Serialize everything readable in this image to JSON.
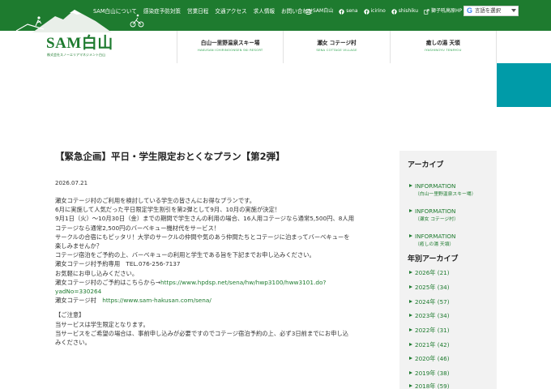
{
  "top_nav": [
    "SAM白山について",
    "感染症予防対策",
    "営業日程",
    "交通アクセス",
    "求人情報",
    "お問い合わせ"
  ],
  "social": [
    {
      "icon": "instagram-icon",
      "label": "SAM白山"
    },
    {
      "icon": "facebook-icon",
      "label": "sena"
    },
    {
      "icon": "facebook-icon",
      "label": "icirino"
    },
    {
      "icon": "facebook-icon",
      "label": "shishiku"
    },
    {
      "icon": "external-link-icon",
      "label": "獅子吼高原HP"
    }
  ],
  "language": {
    "logo": "G",
    "label": "言語を選択"
  },
  "logo": {
    "text": "SAM白山",
    "sub": "株式会社スノーエリアマネジメント白山"
  },
  "main_nav": [
    {
      "title": "白山一里野温泉スキー場",
      "sub": "HAKUSAN ICHIRINOONSEN SKI RESORT"
    },
    {
      "title": "瀬女 コテージ村",
      "sub": "SENA COTTAGE VILLAGE"
    },
    {
      "title": "癒しの湯 天領",
      "sub": "IYASHINOYU TENRYOU"
    }
  ],
  "post": {
    "title": "【緊急企画】平日・学生限定おとくなプラン【第2弾】",
    "date": "2026.07.21",
    "lines": [
      "瀬女コテージ村のご利用を検討している学生の皆さんにお得なプランです。",
      "6月に実施して人気だった平日限定学生割引を第2弾として9月、10月の実施が決定！",
      "9月1日（火）～10月30日（金）までの期間で学生さんの利用の場合、16人用コテージなら通常5,500円、8人用",
      "コテージなら通常2,500円のバーベキュー機材代をサービス！",
      "サークルの合宿にもピッタリ！大学のサークルの仲間や気のあう仲間たちとコテージに泊まってバーベキューを",
      "楽しみませんか？",
      "コテージ宿泊をご予約の上、バーベキューの利用と学生である旨を下記までお申し込みください。",
      "瀬女コテージ村予約専用　TEL.076-256-7137",
      "お気軽にお申し込みください。"
    ],
    "reserve_prefix": "瀬女コテージ村のご予約はこちらから→",
    "reserve_url_1": "https://www.hpdsp.net/sena/hw/hwp3100/hww3101.do?",
    "reserve_url_2": "yadNo=330264",
    "site_prefix": "瀬女コテージ村　",
    "site_url": "https://www.sam-hakusan.com/sena/",
    "notes_title": "【ご注意】",
    "notes": [
      "当サービスは学生限定となります。",
      "当サービスをご希望の場合は、事前申し込みが必要ですのでコテージ宿泊予約の上、必ず3日前までにお申し込",
      "みください。"
    ]
  },
  "sidebar": {
    "archive_title": "アーカイブ",
    "archive": [
      {
        "name": "INFORMATION",
        "sub": "（白山一里野温泉スキー場）"
      },
      {
        "name": "INFORMATION",
        "sub": "（瀬女 コテージ村）"
      },
      {
        "name": "INFORMATION",
        "sub": "（癒しの湯 天領）"
      }
    ],
    "yearly_title": "年別アーカイブ",
    "years": [
      "2026年 (21)",
      "2025年 (34)",
      "2024年 (57)",
      "2023年 (34)",
      "2022年 (31)",
      "2021年 (42)",
      "2020年 (46)",
      "2019年 (38)",
      "2018年 (59)"
    ]
  },
  "colors": {
    "brand_green": "#1e7b2f",
    "teal": "#009ba8",
    "sidebar_bg": "#f2f2f2"
  }
}
